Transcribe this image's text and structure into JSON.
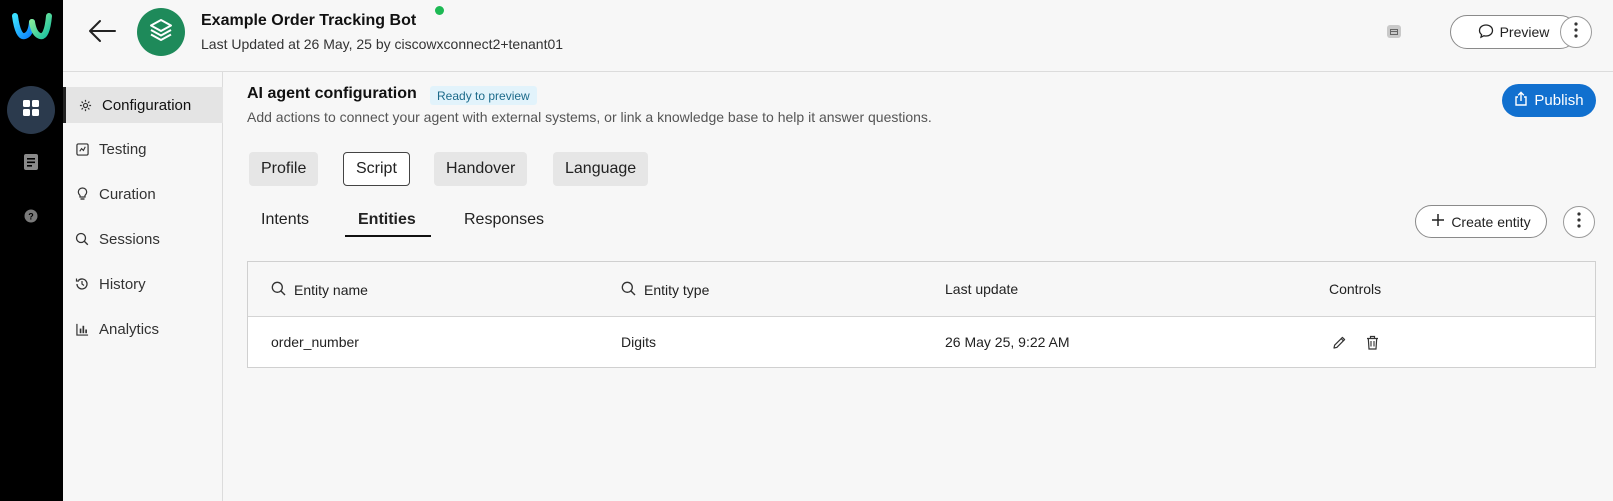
{
  "header": {
    "bot_title": "Example Order Tracking Bot",
    "last_updated": "Last Updated at 26 May, 25 by ciscowxconnect2+tenant01",
    "preview_label": "Preview"
  },
  "leftnav": {
    "items": [
      {
        "label": "Configuration",
        "icon": "gear-icon",
        "active": true
      },
      {
        "label": "Testing",
        "icon": "testing-icon"
      },
      {
        "label": "Curation",
        "icon": "bulb-icon"
      },
      {
        "label": "Sessions",
        "icon": "chat-search-icon"
      },
      {
        "label": "History",
        "icon": "history-icon"
      },
      {
        "label": "Analytics",
        "icon": "analytics-icon"
      }
    ]
  },
  "config": {
    "title": "AI agent configuration",
    "badge": "Ready to preview",
    "description": "Add actions to connect your agent with external systems, or link a knowledge base to help it answer questions.",
    "publish_label": "Publish"
  },
  "section_tabs": [
    "Profile",
    "Script",
    "Handover",
    "Language"
  ],
  "selected_section": "Script",
  "sub_tabs": [
    "Intents",
    "Entities",
    "Responses"
  ],
  "active_sub_tab": "Entities",
  "create_entity_label": "Create entity",
  "table": {
    "columns": [
      "Entity name",
      "Entity type",
      "Last update",
      "Controls"
    ],
    "rows": [
      {
        "name": "order_number",
        "type": "Digits",
        "updated": "26 May 25, 9:22 AM"
      }
    ]
  },
  "colors": {
    "accent": "#1170cf",
    "bot_avatar": "#1e8a5a",
    "online": "#1db954",
    "rail": "#000000"
  }
}
